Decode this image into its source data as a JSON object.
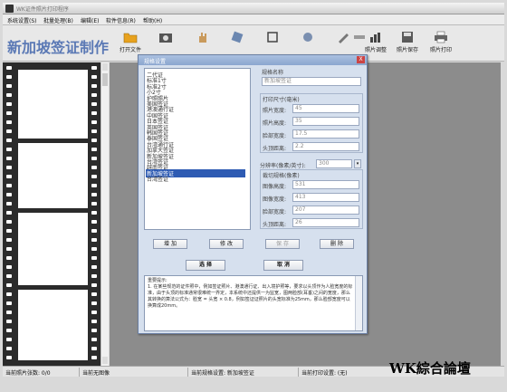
{
  "window": {
    "title": "WK证件照片打印程序"
  },
  "menu": [
    "系统设置(S)",
    "批量处理(B)",
    "编辑(E)",
    "软件信息(R)",
    "帮助(H)"
  ],
  "app_title": "新加坡签证制作",
  "toolbar": [
    {
      "label": "打开文件",
      "icon": "open-folder-icon"
    },
    {
      "label": "",
      "icon": "camera-icon"
    },
    {
      "label": "",
      "icon": "hand-icon"
    },
    {
      "label": "",
      "icon": "rotate-icon"
    },
    {
      "label": "",
      "icon": "crop-icon"
    },
    {
      "label": "",
      "icon": "adjust-icon"
    },
    {
      "label": "",
      "icon": "pen-icon"
    },
    {
      "label": "",
      "icon": "ruler-icon"
    },
    {
      "label": "照片调整",
      "icon": "chart-icon"
    },
    {
      "label": "照片保存",
      "icon": "save-icon"
    },
    {
      "label": "照片打印",
      "icon": "print-icon"
    }
  ],
  "status": {
    "photo_count": "当前照片张数: 0/0",
    "current_image": "当前无图像",
    "spec": "当前规格设置: 新加坡签证",
    "print": "当前打印设置: (无)"
  },
  "watermark": "WK綜合論壇",
  "dialog": {
    "title": "规格设置",
    "close": "X",
    "list": [
      "二代证",
      "标准1寸",
      "标准2寸",
      "小2寸",
      "护照照片",
      "美国签证",
      "港澳通行证",
      "中国签证",
      "日本签证",
      "英国签证",
      "韩国签证",
      "泰国签证",
      "台湾通行证",
      "加拿大签证",
      "新加坡签证",
      "台湾签证",
      "越南签证",
      "新加坡签证",
      "台湾签证"
    ],
    "selected_index": 17,
    "spec_name_label": "规格名称",
    "spec_name_value": "新加坡签证",
    "print_size_label": "打印尺寸(毫米)",
    "photo_width_label": "照片宽度:",
    "photo_width": "45",
    "photo_height_label": "照片高度:",
    "photo_height": "35",
    "face_width_label": "脸部宽度:",
    "face_width": "17.5",
    "top_distance_label": "头顶距离:",
    "top_distance": "2.2",
    "resolution_label": "分辨率(像素/英寸):",
    "resolution": "300",
    "crop_spec_label": "裁切规格(像素)",
    "img_height_label": "图像高度:",
    "img_height": "531",
    "img_width_label": "图像宽度:",
    "img_width": "413",
    "face_px_label": "脸部宽度:",
    "face_px": "207",
    "top_px_label": "头顶距离:",
    "top_px": "26",
    "btn_add": "增 加",
    "btn_modify": "修 改",
    "btn_save": "保 存",
    "btn_delete": "删 除",
    "btn_ok": "选 择",
    "btn_cancel": "取 消",
    "tip_title": "重要提示:",
    "tip_body": "1. 在某些规范的证件照中，例如签证照片、港澳通行证、出入境护照等，要求以头顶作为人脸宽度的标准，由于头顶的标准通常很难统一界定，本系统中还提供一为监宽，图两脸部(耳垂)之间的宽度，那么其转换的算法公式为：脸宽 = 头宽 × 0.8，例如签证证照片的头宽标准为25mm，那么脸部宽度可以换算成20mm。"
  }
}
